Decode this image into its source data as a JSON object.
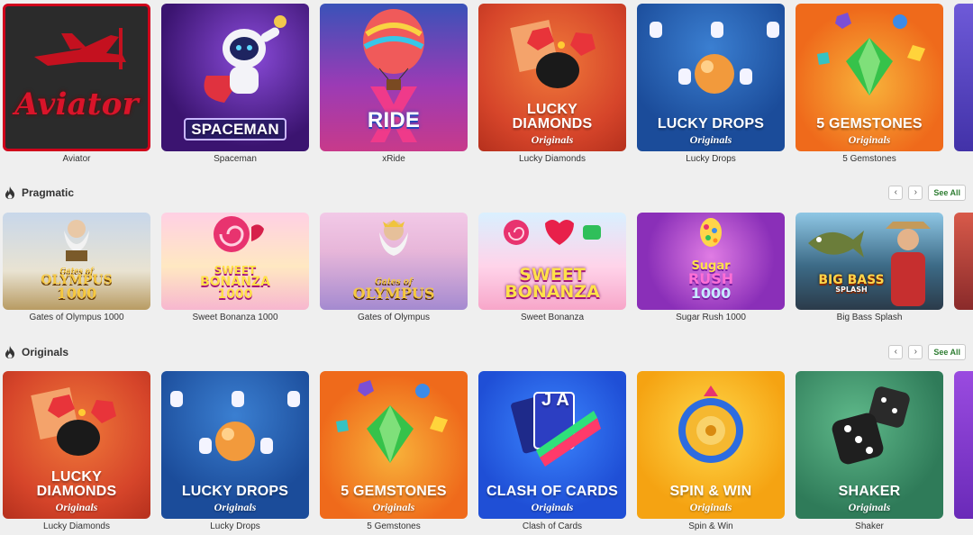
{
  "colors": {
    "page_bg": "#efefef",
    "see_all_text": "#2e7d32",
    "aviator_red": "#d0021b"
  },
  "icons": {
    "section_icon": "fire-icon",
    "prev": "chevron-left-icon",
    "next": "chevron-right-icon"
  },
  "row1": {
    "games": [
      {
        "name": "Aviator",
        "art": "Aviator"
      },
      {
        "name": "Spaceman",
        "art": "SPACEMAN"
      },
      {
        "name": "xRide",
        "art": "RIDE"
      },
      {
        "name": "Lucky Diamonds",
        "art_line1": "LUCKY",
        "art_line2": "DIAMONDS",
        "art_sub": "Originals"
      },
      {
        "name": "Lucky Drops",
        "art": "LUCKY DROPS",
        "art_sub": "Originals"
      },
      {
        "name": "5 Gemstones",
        "art": "5 GEMSTONES",
        "art_sub": "Originals"
      }
    ]
  },
  "sections": [
    {
      "title": "Pragmatic",
      "prev": "‹",
      "next": "›",
      "see_all": "See All",
      "games": [
        {
          "name": "Gates of Olympus 1000",
          "art_line1": "Gates of",
          "art_line2": "OLYMPUS",
          "art_line3": "1000"
        },
        {
          "name": "Sweet Bonanza 1000",
          "art_line1": "SWEET",
          "art_line2": "BONANZA",
          "art_line3": "1000"
        },
        {
          "name": "Gates of Olympus",
          "art_line1": "Gates of",
          "art_line2": "OLYMPUS"
        },
        {
          "name": "Sweet Bonanza",
          "art_line1": "SWEET",
          "art_line2": "BONANZA"
        },
        {
          "name": "Sugar Rush 1000",
          "art_line1": "Sugar",
          "art_line2": "RUSH",
          "art_line3": "1000"
        },
        {
          "name": "Big Bass Splash",
          "art_line1": "BIG BASS",
          "art_line2": "SPLASH"
        }
      ]
    },
    {
      "title": "Originals",
      "prev": "‹",
      "next": "›",
      "see_all": "See All",
      "games": [
        {
          "name": "Lucky Diamonds",
          "art_line1": "LUCKY",
          "art_line2": "DIAMONDS",
          "art_sub": "Originals"
        },
        {
          "name": "Lucky Drops",
          "art": "LUCKY DROPS",
          "art_sub": "Originals"
        },
        {
          "name": "5 Gemstones",
          "art": "5 GEMSTONES",
          "art_sub": "Originals"
        },
        {
          "name": "Clash of Cards",
          "art": "CLASH OF CARDS",
          "art_sub": "Originals",
          "card_letters": "J A"
        },
        {
          "name": "Spin & Win",
          "art": "SPIN & WIN",
          "art_sub": "Originals"
        },
        {
          "name": "Shaker",
          "art": "SHAKER",
          "art_sub": "Originals"
        }
      ]
    }
  ]
}
